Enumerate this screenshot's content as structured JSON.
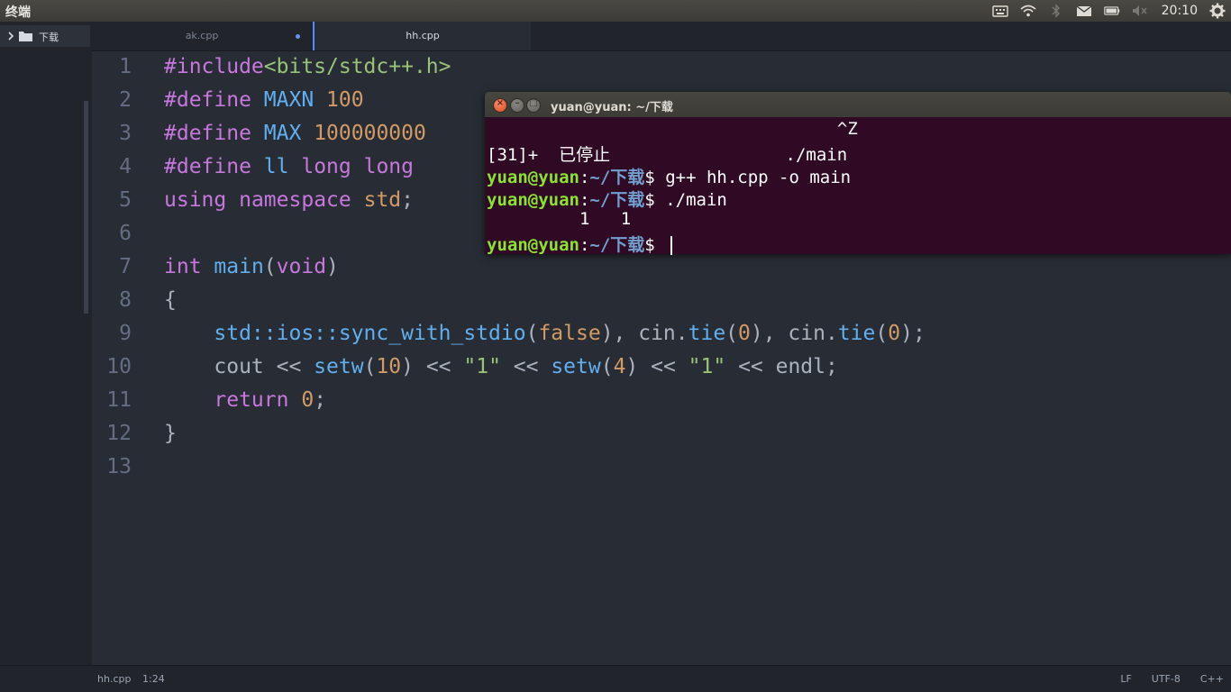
{
  "topbar": {
    "app_title": "终端",
    "clock": "20:10",
    "icons": [
      "keyboard-icon",
      "wifi-icon",
      "bluetooth-icon",
      "mail-icon",
      "battery-icon",
      "volume-muted-icon",
      "gear-icon"
    ]
  },
  "sidebar": {
    "folder_label": "下载"
  },
  "tabs": [
    {
      "label": "ak.cpp",
      "modified": true
    },
    {
      "label": "hh.cpp",
      "active": true
    }
  ],
  "editor": {
    "line_numbers": [
      "1",
      "2",
      "3",
      "4",
      "5",
      "6",
      "7",
      "8",
      "9",
      "10",
      "11",
      "12",
      "13"
    ],
    "code": {
      "l1_a": "#include",
      "l1_b": "<bits/stdc++.h>",
      "l2_a": "#define",
      "l2_b": "MAXN",
      "l2_c": "100",
      "l3_a": "#define",
      "l3_b": "MAX",
      "l3_c": "100000000",
      "l4_a": "#define",
      "l4_b": "ll",
      "l4_c": "long",
      "l4_d": "long",
      "l5_a": "using",
      "l5_b": "namespace",
      "l5_c": "std",
      "l5_d": ";",
      "l7_a": "int",
      "l7_b": "main",
      "l7_c": "(",
      "l7_d": "void",
      "l7_e": ")",
      "l8": "{",
      "l9_a": "std::ios::sync_with_stdio",
      "l9_b": "(",
      "l9_c": "false",
      "l9_d": "), cin.",
      "l9_e": "tie",
      "l9_f": "(",
      "l9_g": "0",
      "l9_h": "), cin.",
      "l9_i": "tie",
      "l9_j": "(",
      "l9_k": "0",
      "l9_l": ");",
      "l10_a": "cout << ",
      "l10_b": "setw",
      "l10_c": "(",
      "l10_d": "10",
      "l10_e": ") << ",
      "l10_f": "\"1\"",
      "l10_g": " << ",
      "l10_h": "setw",
      "l10_i": "(",
      "l10_j": "4",
      "l10_k": ") << ",
      "l10_l": "\"1\"",
      "l10_m": " << endl;",
      "l11_a": "return",
      "l11_b": "0",
      "l11_c": ";",
      "l12": "}"
    }
  },
  "statusbar": {
    "file": "hh.cpp",
    "position": "1:24",
    "line_ending": "LF",
    "encoding": "UTF-8",
    "grammar": "C++"
  },
  "terminal": {
    "title": "yuan@yuan: ~/下载",
    "line1": "                                  ^Z",
    "line2": "[31]+  已停止                 ./main",
    "user": "yuan@yuan",
    "colon": ":",
    "path": "~/下载",
    "dollar": "$ ",
    "cmd1": "g++ hh.cpp -o main",
    "cmd2": "./main",
    "output": "         1   1"
  }
}
